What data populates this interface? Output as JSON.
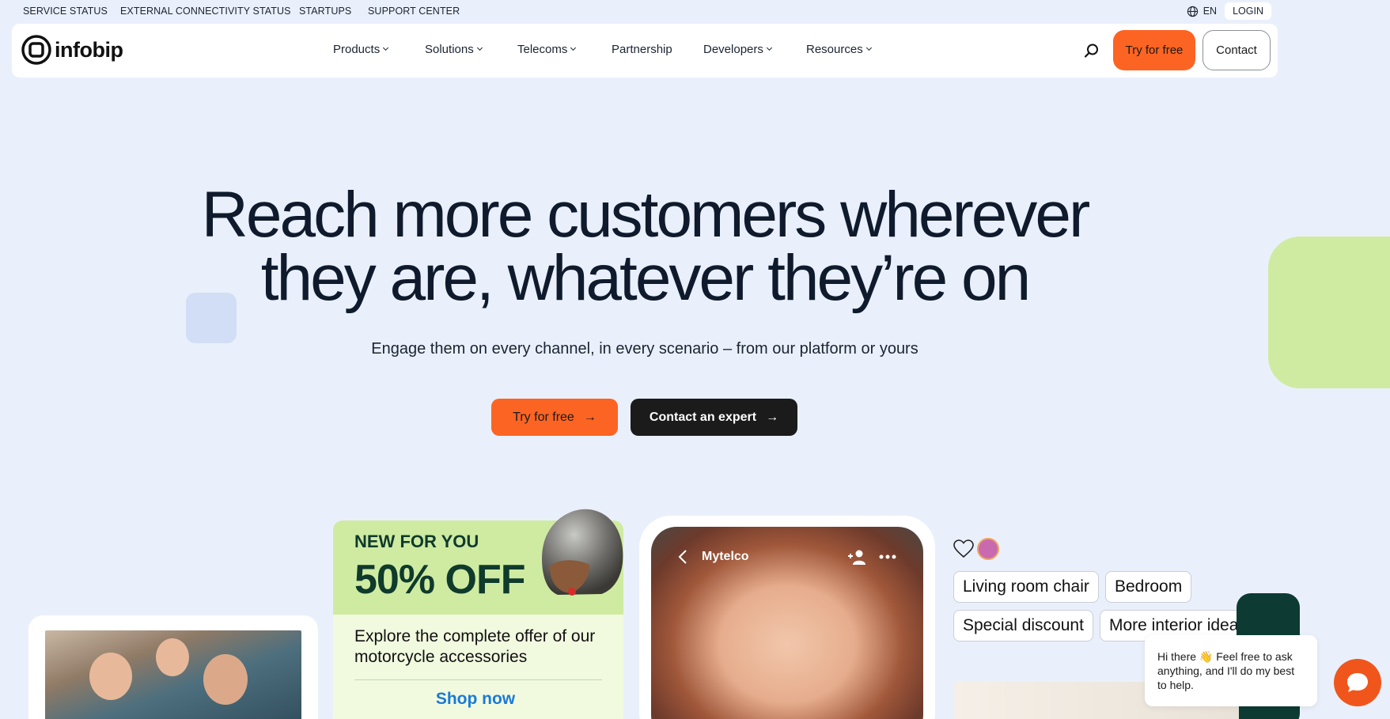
{
  "utility_bar": {
    "links": [
      "SERVICE STATUS",
      "EXTERNAL CONNECTIVITY STATUS",
      "STARTUPS",
      "SUPPORT CENTER"
    ],
    "language": "EN",
    "login": "LOGIN"
  },
  "nav": {
    "logo": "infobip",
    "items": [
      {
        "label": "Products",
        "dropdown": true
      },
      {
        "label": "Solutions",
        "dropdown": true
      },
      {
        "label": "Telecoms",
        "dropdown": true
      },
      {
        "label": "Partnership",
        "dropdown": false
      },
      {
        "label": "Developers",
        "dropdown": true
      },
      {
        "label": "Resources",
        "dropdown": true
      }
    ],
    "search_icon": "search-icon",
    "try_label": "Try for free",
    "contact_label": "Contact"
  },
  "hero": {
    "title_line1": "Reach more customers wherever",
    "title_line2": "they are, whatever they’re on",
    "subtitle": "Engage them on every channel, in every scenario – from our platform or yours",
    "cta_try": "Try for free",
    "cta_contact": "Contact an expert"
  },
  "promo_card": {
    "eyebrow": "NEW FOR YOU",
    "headline": "50% OFF",
    "body": "Explore the complete offer of our motorcycle accessories",
    "link": "Shop now"
  },
  "phone_card": {
    "contact_name": "Mytelco"
  },
  "chips_card": {
    "chips": [
      "Living room chair",
      "Bedroom",
      "Special discount",
      "More interior ideas"
    ]
  },
  "chat": {
    "message": "Hi there 👋 Feel free to ask anything, and I'll do my best to help."
  },
  "colors": {
    "accent_orange": "#fc6423",
    "page_bg": "#eaf0fb",
    "lime": "#cfeba2",
    "dark": "#1b1b1b",
    "link_blue": "#1a7ad8"
  }
}
